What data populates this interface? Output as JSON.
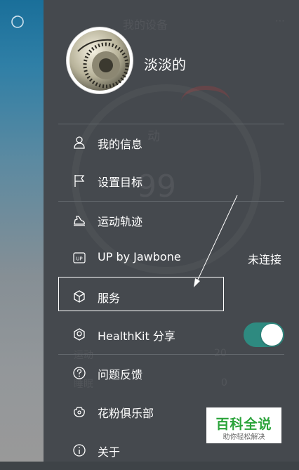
{
  "background": {
    "title": "我的设备",
    "run_label": "动",
    "big_value": "99",
    "row1_label": "运动",
    "row1_value": "20",
    "row2_label": "睡眠",
    "row2_value": "0"
  },
  "profile": {
    "username": "淡淡的"
  },
  "menu": {
    "items": [
      {
        "label": "我的信息",
        "icon": "person-icon"
      },
      {
        "label": "设置目标",
        "icon": "flag-icon"
      },
      {
        "label": "运动轨迹",
        "icon": "running-shoe-icon"
      },
      {
        "label": "UP by Jawbone",
        "icon": "up-badge-icon",
        "right": "未连接"
      },
      {
        "label": "服务",
        "icon": "cube-icon"
      },
      {
        "label": "HealthKit 分享",
        "icon": "healthkit-icon",
        "toggle_on": true
      },
      {
        "label": "问题反馈",
        "icon": "question-icon"
      },
      {
        "label": "花粉俱乐部",
        "icon": "flower-icon"
      },
      {
        "label": "关于",
        "icon": "info-icon"
      }
    ]
  },
  "colors": {
    "drawer_bg": "#45494e",
    "toggle_on": "#2e8a80",
    "watermark_green": "#2aa33a"
  },
  "watermark": {
    "main": "百科全说",
    "sub": "助你轻松解决"
  }
}
